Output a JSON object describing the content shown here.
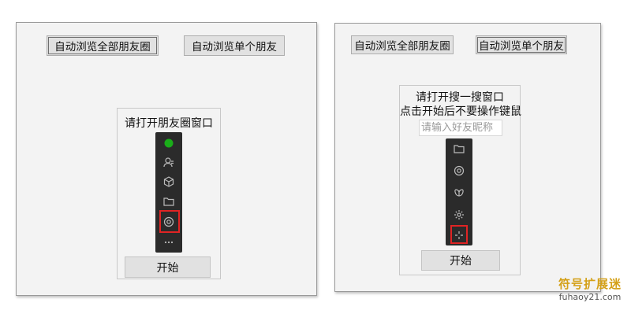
{
  "left_window": {
    "btn_all_moments": "自动浏览全部朋友圈",
    "btn_single_moments": "自动浏览单个朋友",
    "panel_label": "请打开朋友圈窗口",
    "start_label": "开始",
    "bar_icons": [
      "status-dot-icon",
      "contacts-icon",
      "box-icon",
      "folder-icon",
      "moments-icon",
      "more-icon"
    ],
    "highlighted_icon": "moments-icon",
    "status_dot_color": "#1aad19"
  },
  "right_window": {
    "btn_all_moments": "自动浏览全部朋友圈",
    "btn_single_moments": "自动浏览单个朋友",
    "panel_label_line1": "请打开搜一搜窗口",
    "panel_label_line2": "点击开始后不要操作键鼠",
    "input_placeholder": "请输入好友昵称",
    "start_label": "开始",
    "bar_icons": [
      "folder-icon",
      "moments-icon",
      "butterfly-icon",
      "settings-icon",
      "search-icon"
    ],
    "highlighted_icon": "search-icon"
  },
  "watermark": {
    "line1": "符号扩展迷",
    "line2": "fuhaoy21.com"
  },
  "colors": {
    "highlight": "#e02424",
    "sidebar_bg": "#2b2b2b",
    "watermark": "#d4a017"
  }
}
